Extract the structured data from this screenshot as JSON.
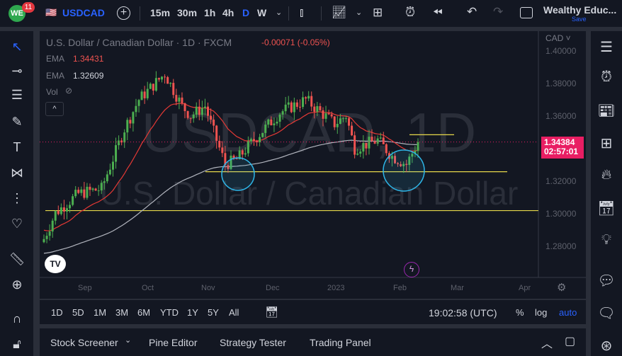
{
  "header": {
    "logo": "WE",
    "notifications": "11",
    "symbol": "USDCAD",
    "intervals": [
      "15m",
      "30m",
      "1h",
      "4h",
      "D",
      "W"
    ],
    "active_interval": "D",
    "account": "Wealthy Educ...",
    "save": "Save"
  },
  "legend": {
    "title": "U.S. Dollar / Canadian Dollar · 1D · FXCM",
    "change": "-0.00071 (-0.05%)",
    "ema1_label": "EMA",
    "ema1": "1.34431",
    "ema2_label": "EMA",
    "ema2": "1.32609",
    "vol": "Vol"
  },
  "watermark": {
    "symbol": "USDCAD, 1D",
    "name": "U.S. Dollar / Canadian Dollar"
  },
  "price_axis": {
    "currency": "CAD",
    "ticks": [
      "1.40000",
      "1.38000",
      "1.36000",
      "1.34000",
      "1.32000",
      "1.30000",
      "1.28000"
    ],
    "last_price": "1.34384",
    "countdown": "02:57:01"
  },
  "time_axis": [
    "Sep",
    "Oct",
    "Nov",
    "Dec",
    "2023",
    "Feb",
    "Mar",
    "Apr"
  ],
  "ranges": [
    "1D",
    "5D",
    "1M",
    "3M",
    "6M",
    "YTD",
    "1Y",
    "5Y",
    "All"
  ],
  "clock": "19:02:58 (UTC)",
  "scale_opts": [
    "%",
    "log",
    "auto"
  ],
  "panels": [
    "Stock Screener",
    "Pine Editor",
    "Strategy Tester",
    "Trading Panel"
  ],
  "colors": {
    "up": "#26a69a",
    "upcandle": "#4caf50",
    "down": "#ef5350",
    "accent": "#2962ff",
    "ema_fast": "#e53935",
    "ema_slow": "#b2b5be",
    "level": "#e6d84a",
    "circle": "#2eb6e8",
    "price_tag": "#e91e63"
  },
  "chart_data": {
    "type": "candlestick",
    "ylim": [
      1.27,
      1.405
    ],
    "xlabel": "",
    "ylabel": "CAD",
    "keypoints": [
      [
        "Aug16",
        1.284
      ],
      [
        "Aug22",
        1.3
      ],
      [
        "Sep1",
        1.312
      ],
      [
        "Sep13",
        1.315
      ],
      [
        "Sep23",
        1.352
      ],
      [
        "Sep30",
        1.37
      ],
      [
        "Oct13",
        1.386
      ],
      [
        "Oct21",
        1.366
      ],
      [
        "Oct25",
        1.36
      ],
      [
        "Nov1",
        1.366
      ],
      [
        "Nov4",
        1.35
      ],
      [
        "Nov10",
        1.33
      ],
      [
        "Nov16",
        1.333
      ],
      [
        "Nov25",
        1.347
      ],
      [
        "Dec5",
        1.362
      ],
      [
        "Dec16",
        1.37
      ],
      [
        "Dec30",
        1.355
      ],
      [
        "Jan5",
        1.36
      ],
      [
        "Jan10",
        1.34
      ],
      [
        "Jan20",
        1.345
      ],
      [
        "Jan27",
        1.335
      ],
      [
        "Feb2",
        1.33
      ],
      [
        "Feb8",
        1.3438
      ]
    ],
    "levels": [
      1.3483,
      1.3255,
      1.3015
    ]
  }
}
